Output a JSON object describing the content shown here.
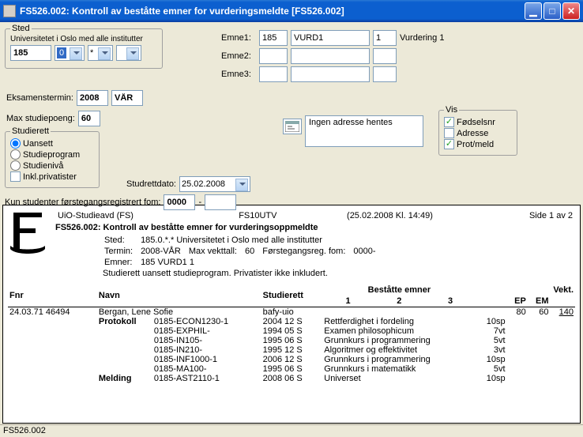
{
  "window": {
    "title": "FS526.002: Kontroll av beståtte emner for vurderingsmeldte  [FS526.002]"
  },
  "sted": {
    "legend": "Sted",
    "org": "Universitetet i Oslo med alle institutter",
    "code": "185",
    "sub1": "0",
    "sub2": "*",
    "sub3": "",
    "eksamenstermin_label": "Eksamenstermin:",
    "eksamenstermin_year": "2008",
    "eksamenstermin_sem": "VÅR",
    "maxpoeng_label": "Max studiepoeng:",
    "maxpoeng": "60"
  },
  "emne": {
    "label1": "Emne1:",
    "label2": "Emne2:",
    "label3": "Emne3:",
    "e1_a": "185",
    "e1_b": "VURD1",
    "e1_c": "1",
    "e1_tail": "Vurdering 1",
    "e2_a": "",
    "e2_b": "",
    "e2_c": "",
    "e3_a": "",
    "e3_b": "",
    "e3_c": ""
  },
  "addr": {
    "text": "Ingen adresse hentes"
  },
  "vis": {
    "legend": "Vis",
    "fodselsnr": "Fødselsnr",
    "adresse": "Adresse",
    "protmeld": "Prot/meld"
  },
  "studierett": {
    "legend": "Studierett",
    "uansett": "Uansett",
    "studieprogram": "Studieprogram",
    "studieniva": "Studienivå",
    "inkl_privatister": "Inkl.privatister",
    "studrettdato_label": "Studrettdato:",
    "studrettdato": "25.02.2008"
  },
  "forstegang": {
    "label": "Kun studenter førstegangsregistrert fom:",
    "from": "0000",
    "to": ""
  },
  "report": {
    "header_left": "UiO-Studieavd (FS)",
    "header_mid": "FS10UTV",
    "header_time": "(25.02.2008 Kl. 14:49)",
    "header_right": "Side 1 av 2",
    "title": "FS526.002: Kontroll av beståtte emner for vurderingsoppmeldte",
    "sted_label": "Sted:",
    "sted_val": "185.0.*.* Universitetet i Oslo med alle institutter",
    "termin_label": "Termin:",
    "termin_val": "2008-VÅR",
    "maxvekt_label": "Max vekttall:",
    "maxvekt_val": "60",
    "fgang_label": "Førstegangsreg. fom:",
    "fgang_val": "0000-",
    "emner_label": "Emner:",
    "emner_val": "185 VURD1 1",
    "note": "Studierett uansett studieprogram. Privatister ikke inkludert."
  },
  "cols": {
    "fnr": "Fnr",
    "navn": "Navn",
    "studierett": "Studierett",
    "bestatte": "Beståtte emner",
    "c1": "1",
    "c2": "2",
    "c3": "3",
    "vekt": "Vekt.",
    "ep": "EP",
    "em": "EM",
    "tot": ""
  },
  "student": {
    "fnr": "24.03.71 46494",
    "navn": "Bergan, Lene Sofie",
    "studierett": "bafy-uio",
    "ep": "80",
    "em": "60",
    "tot": "140"
  },
  "labels": {
    "protokoll": "Protokoll",
    "melding": "Melding"
  },
  "rows": [
    {
      "code": "0185-ECON1230-1",
      "term": "2004 12 S",
      "name": "Rettferdighet i fordeling",
      "sp": "10sp"
    },
    {
      "code": "0185-EXPHIL-",
      "term": "1994 05 S",
      "name": "Examen philosophicum",
      "sp": "7vt"
    },
    {
      "code": "0185-IN105-",
      "term": "1995 06 S",
      "name": "Grunnkurs i programmering",
      "sp": "5vt"
    },
    {
      "code": "0185-IN210-",
      "term": "1995 12 S",
      "name": "Algoritmer og effektivitet",
      "sp": "3vt"
    },
    {
      "code": "0185-INF1000-1",
      "term": "2006 12 S",
      "name": "Grunnkurs i programmering",
      "sp": "10sp"
    },
    {
      "code": "0185-MA100-",
      "term": "1995 06 S",
      "name": "Grunnkurs i matematikk",
      "sp": "5vt"
    },
    {
      "code": "0185-AST2110-1",
      "term": "2008 06 S",
      "name": "Universet",
      "sp": "10sp"
    }
  ],
  "status": "FS526.002"
}
